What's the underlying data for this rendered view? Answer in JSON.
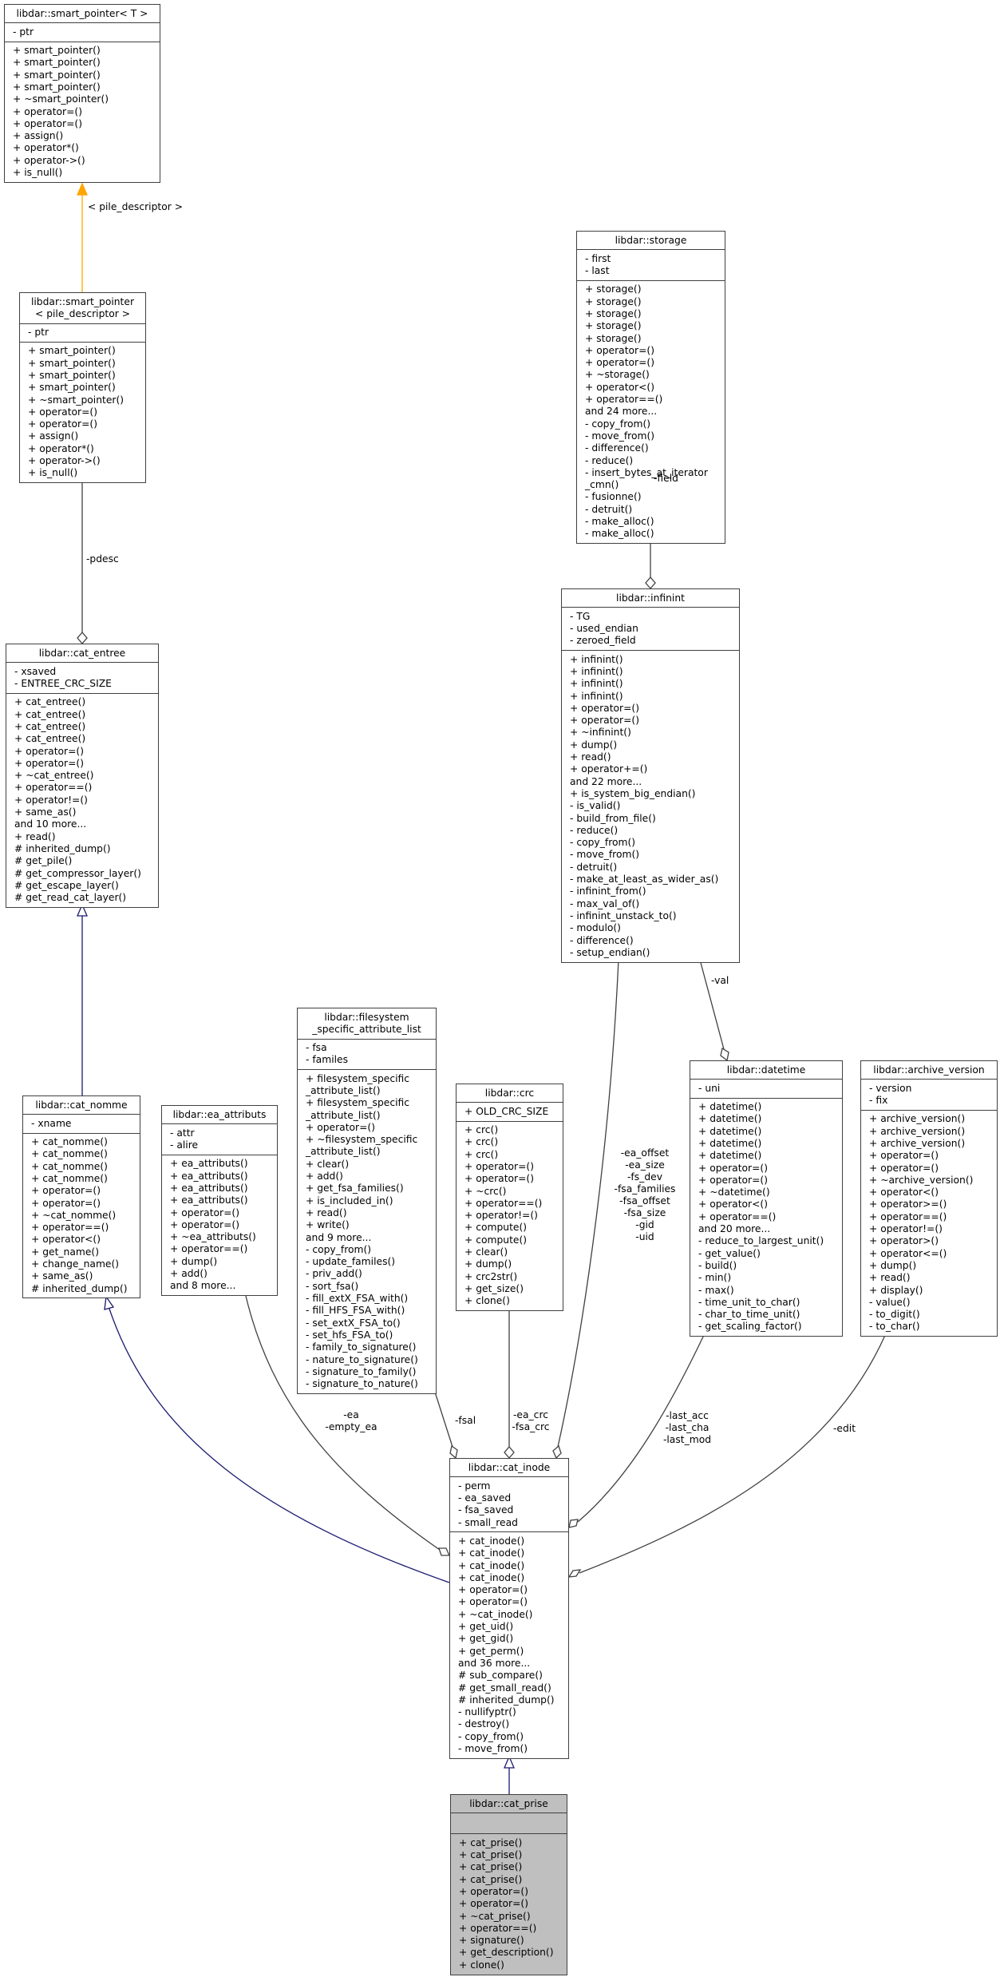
{
  "colors": {
    "inheritance": "#191970",
    "template": "#ffa500",
    "usage": "#404040",
    "focus_fill": "#bfbfbf"
  },
  "boxes": [
    {
      "id": "smart_pointer_T",
      "title": [
        "libdar::smart_pointer< T >"
      ],
      "attributes": [
        "- ptr"
      ],
      "methods": [
        "+ smart_pointer()",
        "+ smart_pointer()",
        "+ smart_pointer()",
        "+ smart_pointer()",
        "+ ~smart_pointer()",
        "+ operator=()",
        "+ operator=()",
        "+ assign()",
        "+ operator*()",
        "+ operator->()",
        "+ is_null()"
      ]
    },
    {
      "id": "smart_pointer_pile",
      "title": [
        "libdar::smart_pointer",
        "< pile_descriptor >"
      ],
      "attributes": [
        "- ptr"
      ],
      "methods": [
        "+ smart_pointer()",
        "+ smart_pointer()",
        "+ smart_pointer()",
        "+ smart_pointer()",
        "+ ~smart_pointer()",
        "+ operator=()",
        "+ operator=()",
        "+ assign()",
        "+ operator*()",
        "+ operator->()",
        "+ is_null()"
      ]
    },
    {
      "id": "storage",
      "title": [
        "libdar::storage"
      ],
      "attributes": [
        "- first",
        "- last"
      ],
      "methods": [
        "+ storage()",
        "+ storage()",
        "+ storage()",
        "+ storage()",
        "+ storage()",
        "+ operator=()",
        "+ operator=()",
        "+ ~storage()",
        "+ operator<()",
        "+ operator==()",
        "and 24 more...",
        "- copy_from()",
        "- move_from()",
        "- difference()",
        "- reduce()",
        "- insert_bytes_at_iterator",
        "_cmn()",
        "- fusionne()",
        "- detruit()",
        "- make_alloc()",
        "- make_alloc()"
      ]
    },
    {
      "id": "infinint",
      "title": [
        "libdar::infinint"
      ],
      "attributes": [
        "- TG",
        "- used_endian",
        "- zeroed_field"
      ],
      "methods": [
        "+ infinint()",
        "+ infinint()",
        "+ infinint()",
        "+ infinint()",
        "+ operator=()",
        "+ operator=()",
        "+ ~infinint()",
        "+ dump()",
        "+ read()",
        "+ operator+=()",
        "and 22 more...",
        "+ is_system_big_endian()",
        "- is_valid()",
        "- build_from_file()",
        "- reduce()",
        "- copy_from()",
        "- move_from()",
        "- detruit()",
        "- make_at_least_as_wider_as()",
        "- infinint_from()",
        "- max_val_of()",
        "- infinint_unstack_to()",
        "- modulo()",
        "- difference()",
        "- setup_endian()"
      ]
    },
    {
      "id": "cat_entree",
      "title": [
        "libdar::cat_entree"
      ],
      "attributes": [
        "- xsaved",
        "- ENTREE_CRC_SIZE"
      ],
      "methods": [
        "+ cat_entree()",
        "+ cat_entree()",
        "+ cat_entree()",
        "+ cat_entree()",
        "+ operator=()",
        "+ operator=()",
        "+ ~cat_entree()",
        "+ operator==()",
        "+ operator!=()",
        "+ same_as()",
        "and 10 more...",
        "+ read()",
        "# inherited_dump()",
        "# get_pile()",
        "# get_compressor_layer()",
        "# get_escape_layer()",
        "# get_read_cat_layer()"
      ]
    },
    {
      "id": "cat_nomme",
      "title": [
        "libdar::cat_nomme"
      ],
      "attributes": [
        "- xname"
      ],
      "methods": [
        "+ cat_nomme()",
        "+ cat_nomme()",
        "+ cat_nomme()",
        "+ cat_nomme()",
        "+ operator=()",
        "+ operator=()",
        "+ ~cat_nomme()",
        "+ operator==()",
        "+ operator<()",
        "+ get_name()",
        "+ change_name()",
        "+ same_as()",
        "# inherited_dump()"
      ]
    },
    {
      "id": "ea_attributs",
      "title": [
        "libdar::ea_attributs"
      ],
      "attributes": [
        "- attr",
        "- alire"
      ],
      "methods": [
        "+ ea_attributs()",
        "+ ea_attributs()",
        "+ ea_attributs()",
        "+ ea_attributs()",
        "+ operator=()",
        "+ operator=()",
        "+ ~ea_attributs()",
        "+ operator==()",
        "+ dump()",
        "+ add()",
        "and 8 more..."
      ]
    },
    {
      "id": "filesystem_specific_attribute_list",
      "title": [
        "libdar::filesystem",
        "_specific_attribute_list"
      ],
      "attributes": [
        "- fsa",
        "- familes"
      ],
      "methods": [
        "+ filesystem_specific",
        "_attribute_list()",
        "+ filesystem_specific",
        "_attribute_list()",
        "+ operator=()",
        "+ ~filesystem_specific",
        "_attribute_list()",
        "+ clear()",
        "+ add()",
        "+ get_fsa_families()",
        "+ is_included_in()",
        "+ read()",
        "+ write()",
        "and 9 more...",
        "- copy_from()",
        "- update_familes()",
        "- priv_add()",
        "- sort_fsa()",
        "- fill_extX_FSA_with()",
        "- fill_HFS_FSA_with()",
        "- set_extX_FSA_to()",
        "- set_hfs_FSA_to()",
        "- family_to_signature()",
        "- nature_to_signature()",
        "- signature_to_family()",
        "- signature_to_nature()"
      ]
    },
    {
      "id": "crc",
      "title": [
        "libdar::crc"
      ],
      "attributes": [
        "+ OLD_CRC_SIZE"
      ],
      "methods": [
        "+ crc()",
        "+ crc()",
        "+ crc()",
        "+ operator=()",
        "+ operator=()",
        "+ ~crc()",
        "+ operator==()",
        "+ operator!=()",
        "+ compute()",
        "+ compute()",
        "+ clear()",
        "+ dump()",
        "+ crc2str()",
        "+ get_size()",
        "+ clone()"
      ]
    },
    {
      "id": "datetime",
      "title": [
        "libdar::datetime"
      ],
      "attributes": [
        "- uni"
      ],
      "methods": [
        "+ datetime()",
        "+ datetime()",
        "+ datetime()",
        "+ datetime()",
        "+ datetime()",
        "+ operator=()",
        "+ operator=()",
        "+ ~datetime()",
        "+ operator<()",
        "+ operator==()",
        "and 20 more...",
        "- reduce_to_largest_unit()",
        "- get_value()",
        "- build()",
        "- min()",
        "- max()",
        "- time_unit_to_char()",
        "- char_to_time_unit()",
        "- get_scaling_factor()"
      ]
    },
    {
      "id": "archive_version",
      "title": [
        "libdar::archive_version"
      ],
      "attributes": [
        "- version",
        "- fix"
      ],
      "methods": [
        "+ archive_version()",
        "+ archive_version()",
        "+ archive_version()",
        "+ operator=()",
        "+ operator=()",
        "+ ~archive_version()",
        "+ operator<()",
        "+ operator>=()",
        "+ operator==()",
        "+ operator!=()",
        "+ operator>()",
        "+ operator<=()",
        "+ dump()",
        "+ read()",
        "+ display()",
        "- value()",
        "- to_digit()",
        "- to_char()"
      ]
    },
    {
      "id": "cat_inode",
      "title": [
        "libdar::cat_inode"
      ],
      "attributes": [
        "- perm",
        "- ea_saved",
        "- fsa_saved",
        "- small_read"
      ],
      "methods": [
        "+ cat_inode()",
        "+ cat_inode()",
        "+ cat_inode()",
        "+ cat_inode()",
        "+ operator=()",
        "+ operator=()",
        "+ ~cat_inode()",
        "+ get_uid()",
        "+ get_gid()",
        "+ get_perm()",
        "and 36 more...",
        "# sub_compare()",
        "# get_small_read()",
        "# inherited_dump()",
        "- nullifyptr()",
        "- destroy()",
        "- copy_from()",
        "- move_from()"
      ]
    },
    {
      "id": "cat_prise",
      "title": [
        "libdar::cat_prise"
      ],
      "attributes": [],
      "focus": true,
      "methods": [
        "+ cat_prise()",
        "+ cat_prise()",
        "+ cat_prise()",
        "+ cat_prise()",
        "+ operator=()",
        "+ operator=()",
        "+ ~cat_prise()",
        "+ operator==()",
        "+ signature()",
        "+ get_description()",
        "+ clone()"
      ]
    }
  ],
  "edge_labels": {
    "template_arg": [
      "< pile_descriptor >"
    ],
    "pdesc": [
      "-pdesc"
    ],
    "field": [
      "-field"
    ],
    "val": [
      "-val"
    ],
    "infinint_fields": [
      "-ea_offset",
      "-ea_size",
      "-fs_dev",
      "-fsa_families",
      "-fsa_offset",
      "-fsa_size",
      "-gid",
      "-uid"
    ],
    "ea": [
      "-ea",
      "-empty_ea"
    ],
    "fsal": [
      "-fsal"
    ],
    "crc": [
      "-ea_crc",
      "-fsa_crc"
    ],
    "datetime": [
      "-last_acc",
      "-last_cha",
      "-last_mod"
    ],
    "edit": [
      "-edit"
    ]
  }
}
